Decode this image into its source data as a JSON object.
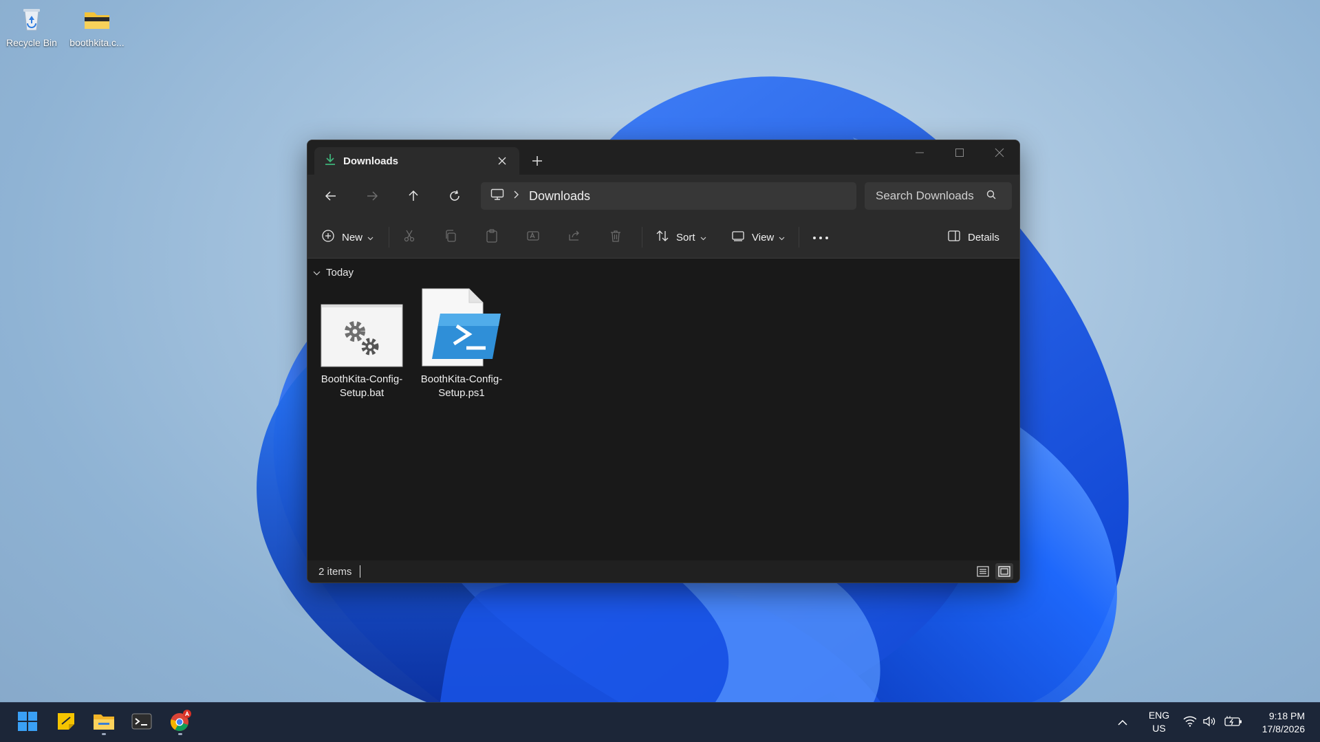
{
  "desktop": {
    "icons": [
      {
        "label": "Recycle Bin",
        "icon": "recycle-bin-icon"
      },
      {
        "label": "boothkita.c...",
        "icon": "folder-icon"
      }
    ]
  },
  "window": {
    "tab": {
      "title": "Downloads",
      "icon": "download-icon"
    },
    "address": {
      "crumb": "Downloads"
    },
    "search": {
      "placeholder": "Search Downloads"
    },
    "toolbar": {
      "new_label": "New",
      "sort_label": "Sort",
      "view_label": "View",
      "details_label": "Details"
    },
    "group": {
      "label": "Today"
    },
    "files": [
      {
        "name": "BoothKita-Config-Setup.bat",
        "icon": "batch-file-icon"
      },
      {
        "name": "BoothKita-Config-Setup.ps1",
        "icon": "powershell-script-icon"
      }
    ],
    "status": {
      "items": "2 items"
    }
  },
  "taskbar": {
    "apps": [
      "start-icon",
      "sticky-notes-icon",
      "file-explorer-icon",
      "terminal-icon",
      "chrome-icon"
    ],
    "language": {
      "line1": "ENG",
      "line2": "US"
    },
    "clock": {
      "time": "9:18 PM",
      "date": "17/8/2026"
    }
  },
  "colors": {
    "window_bg": "#191919",
    "chrome_bg": "#2b2b2b",
    "taskbar_bg": "#1c2638",
    "accent": "#0078d4"
  }
}
